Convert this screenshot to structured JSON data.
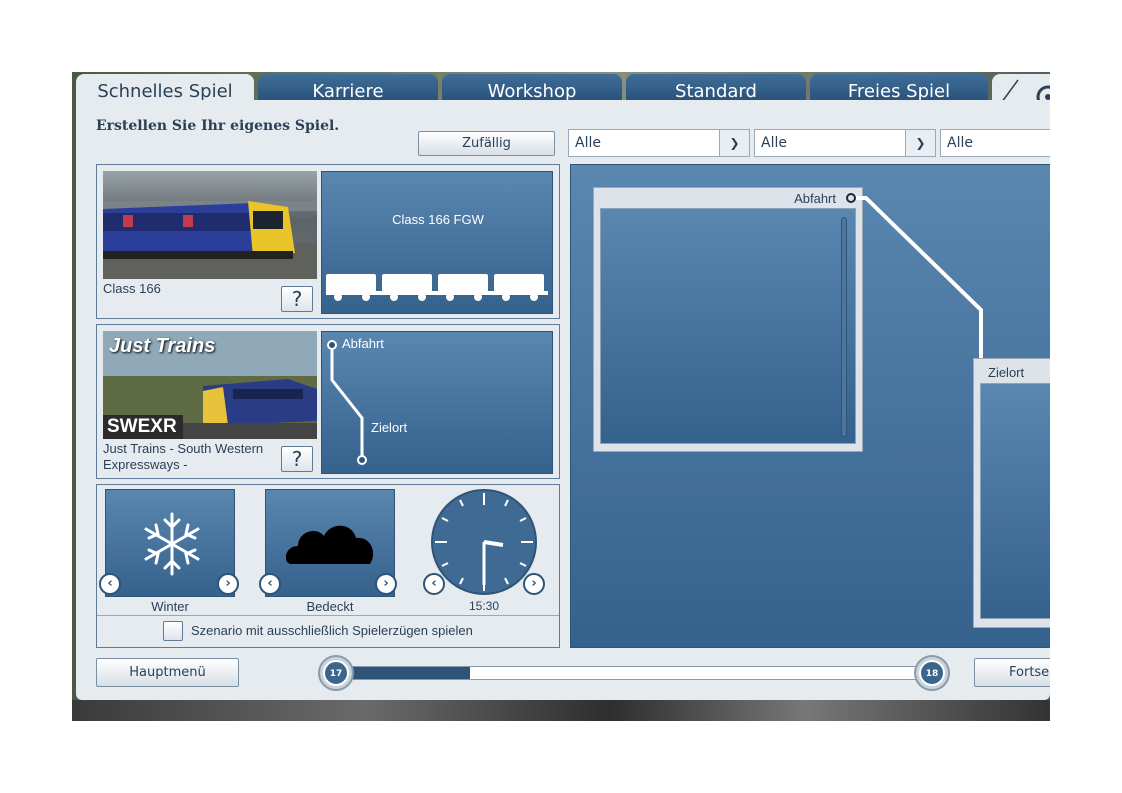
{
  "tabs": [
    {
      "label": "Schnelles Spiel",
      "active": true
    },
    {
      "label": "Karriere"
    },
    {
      "label": "Workshop"
    },
    {
      "label": "Standard"
    },
    {
      "label": "Freies Spiel"
    }
  ],
  "heading": "Erstellen Sie Ihr eigenes Spiel.",
  "random_button": "Zufällig",
  "filters": [
    "Alle",
    "Alle",
    "Alle"
  ],
  "train": {
    "name": "Class 166",
    "consist": "Class 166 FGW",
    "help": "?"
  },
  "route": {
    "name": "Just Trains - South Western Expressways -",
    "badge": "SWEXR",
    "brand": "Just Trains",
    "help": "?",
    "departure": "Abfahrt",
    "destination": "Zielort"
  },
  "conditions": {
    "season": "Winter",
    "weather": "Bedeckt",
    "time": "15:30"
  },
  "player_only_checkbox": {
    "label": "Szenario mit ausschließlich Spielerzügen spielen",
    "checked": false
  },
  "map": {
    "departure": "Abfahrt",
    "destination": "Zielort"
  },
  "footer": {
    "main_menu": "Hauptmenü",
    "continue": "Fortse",
    "slider_start": "17",
    "slider_end": "18",
    "slider_progress": 0.22
  },
  "colors": {
    "tab_active_bg": "#e6ebef",
    "tab_bg": "#2a5580",
    "panel_blue": "#3e6a94",
    "accent": "#2e5478"
  }
}
